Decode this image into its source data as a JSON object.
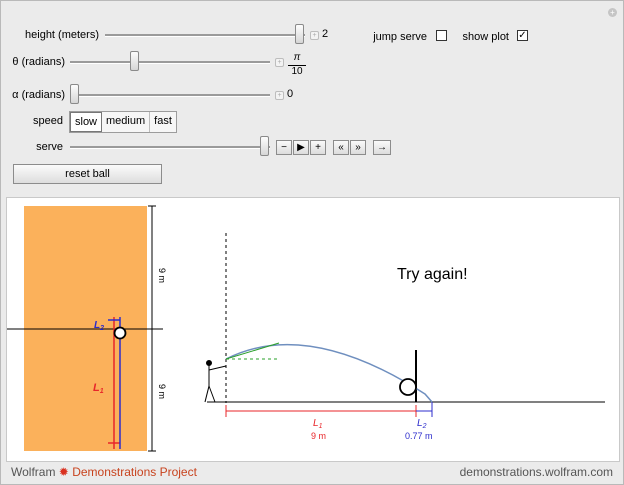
{
  "controls": {
    "height": {
      "label": "height (meters)",
      "value": "2",
      "level": 1.0
    },
    "theta": {
      "label": "θ (radians)",
      "value_num": "π",
      "value_den": "10",
      "level": 0.33
    },
    "alpha": {
      "label": "α (radians)",
      "value": "0",
      "level": 0.0
    },
    "speed": {
      "label": "speed",
      "options": [
        "slow",
        "medium",
        "fast"
      ],
      "selected": "slow"
    },
    "serve": {
      "label": "serve",
      "level": 1.0,
      "buttons": [
        "−",
        "▶",
        "+",
        "«",
        "»",
        "→"
      ]
    },
    "jump_serve": {
      "label": "jump serve",
      "checked": false
    },
    "show_plot": {
      "label": "show plot",
      "checked": true,
      "mark": "✓"
    },
    "reset": {
      "label": "reset ball"
    }
  },
  "plot": {
    "message": "Try again!",
    "court_labels": {
      "L2": "L",
      "L2_sub": "2",
      "L1": "L",
      "L1_sub": "1",
      "upper_dim": "9 m",
      "lower_dim": "9 m"
    },
    "side_labels": {
      "L1": "L",
      "L1_sub": "1",
      "L1_value": "9 m",
      "L2": "L",
      "L2_sub": "2",
      "L2_value": "0.77 m"
    },
    "colors": {
      "court": "#fbb15b",
      "arc": "#6f8fbf",
      "red": "#e8262a",
      "blue": "#2c2ccc",
      "green": "#2aa02a"
    }
  },
  "footer": {
    "left_prefix": "Wolfram",
    "left_main": "Demonstrations Project",
    "right": "demonstrations.wolfram.com"
  }
}
